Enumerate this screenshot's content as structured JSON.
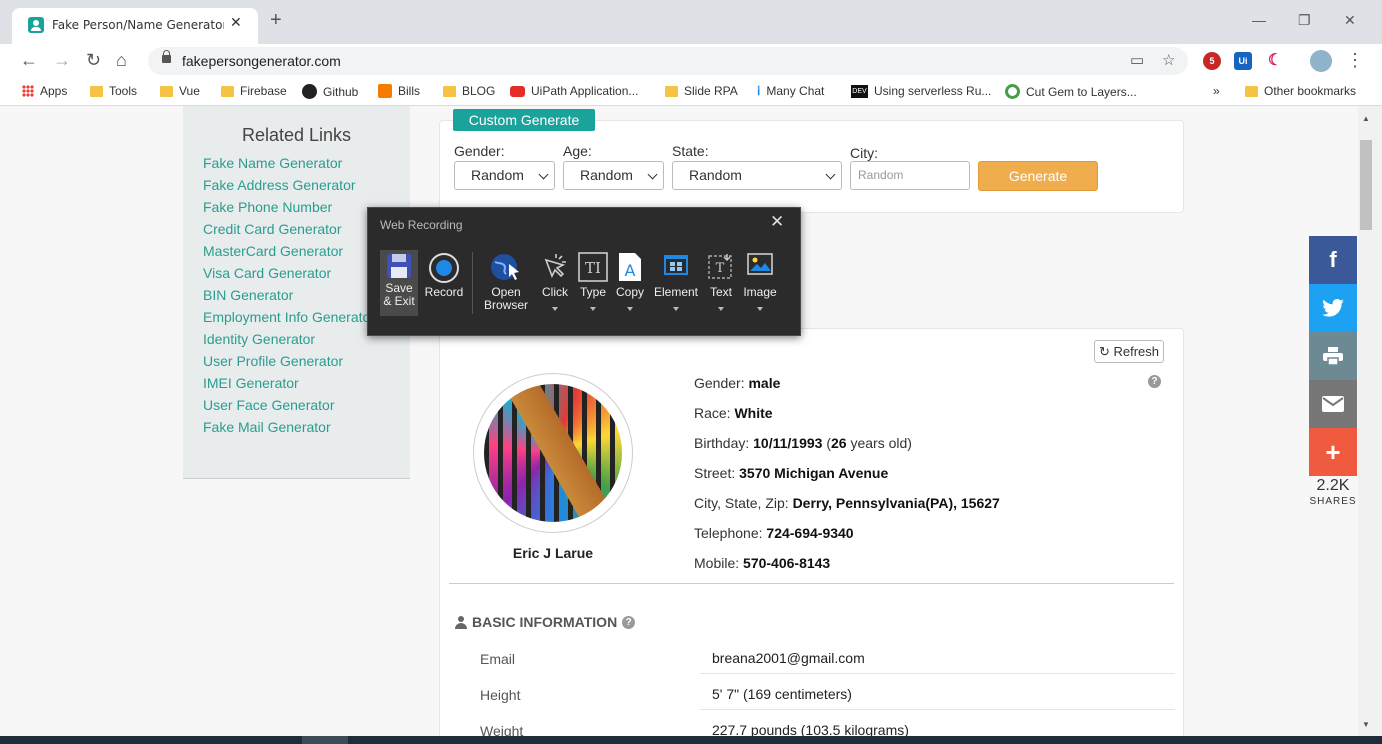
{
  "browser": {
    "tab_title": "Fake Person/Name Generator | U",
    "tab_close": "✕",
    "new_tab": "+",
    "url": "fakepersongenerator.com",
    "window_minimize": "—",
    "window_restore": "❐",
    "window_close": "✕"
  },
  "bookmarks": [
    "Apps",
    "Tools",
    "Vue",
    "Firebase",
    "Github",
    "Bills",
    "BLOG",
    "UiPath Application...",
    "Slide RPA",
    "Many Chat",
    "Using serverless Ru...",
    "Cut Gem to Layers..."
  ],
  "bookmarks_more": "»",
  "other_bookmarks": "Other bookmarks",
  "extensions": {
    "abp_badge": "5",
    "uipath": "Ui"
  },
  "sidebar": {
    "title": "Related Links",
    "links": [
      "Fake Name Generator",
      "Fake Address Generator",
      "Fake Phone Number",
      "Credit Card Generator",
      "MasterCard Generator",
      "Visa Card Generator",
      "BIN Generator",
      "Employment Info Generator",
      "Identity Generator",
      "User Profile Generator",
      "IMEI Generator",
      "User Face Generator",
      "Fake Mail Generator"
    ]
  },
  "custom": {
    "badge": "Custom Generate",
    "gender_label": "Gender:",
    "gender_value": "Random",
    "age_label": "Age:",
    "age_value": "Random",
    "state_label": "State:",
    "state_value": "Random",
    "city_label": "City:",
    "city_placeholder": "Random",
    "generate": "Generate"
  },
  "recorder": {
    "title": "Web Recording",
    "close": "✕",
    "save_line1": "Save",
    "save_line2": "& Exit",
    "record": "Record",
    "open_line1": "Open",
    "open_line2": "Browser",
    "click": "Click",
    "type": "Type",
    "copy": "Copy",
    "element": "Element",
    "text": "Text",
    "image": "Image"
  },
  "person": {
    "refresh": "Refresh",
    "name": "Eric J Larue",
    "gender_label": "Gender:",
    "gender": "male",
    "race_label": "Race:",
    "race": "White",
    "birthday_label": "Birthday:",
    "birthday": "10/11/1993",
    "age": "26",
    "age_suffix": "years old)",
    "street_label": "Street:",
    "street": "3570 Michigan Avenue",
    "csz_label": "City, State, Zip:",
    "csz": "Derry, Pennsylvania(PA), 15627",
    "telephone_label": "Telephone:",
    "telephone": "724-694-9340",
    "mobile_label": "Mobile:",
    "mobile": "570-406-8143"
  },
  "basic": {
    "title": "BASIC INFORMATION",
    "rows": [
      {
        "label": "Email",
        "value": "breana2001@gmail.com"
      },
      {
        "label": "Height",
        "value": "5' 7\" (169 centimeters)"
      },
      {
        "label": "Weight",
        "value": "227.7 pounds (103.5 kilograms)"
      }
    ]
  },
  "share": {
    "count": "2.2K",
    "label": "SHARES",
    "facebook": "f",
    "plus": "+"
  },
  "colors": {
    "accent": "#1aa39a",
    "generate": "#efad4d",
    "facebook": "#3b5998",
    "twitter": "#1da1f2",
    "print": "#6d8a94",
    "email": "#777777",
    "plus": "#f05a3e"
  }
}
